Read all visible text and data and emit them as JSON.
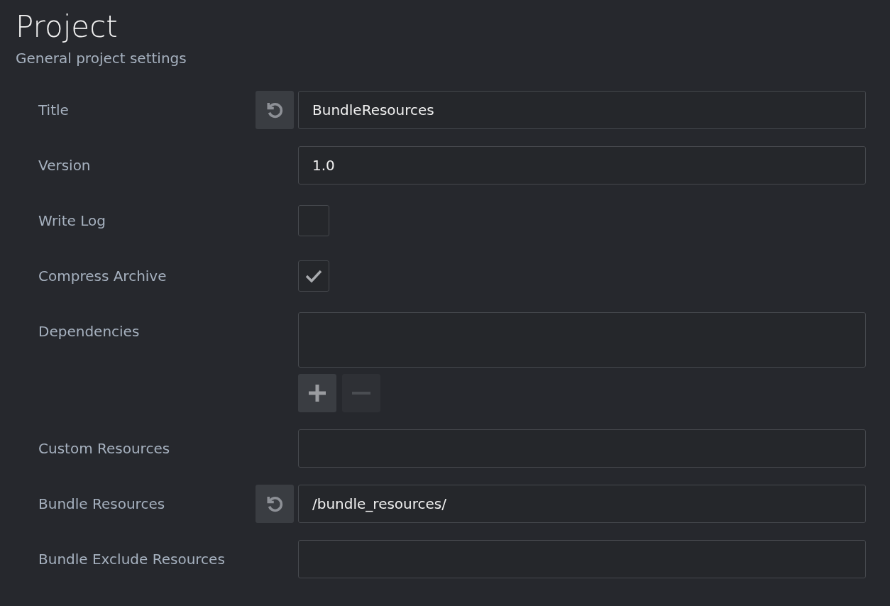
{
  "header": {
    "title": "Project",
    "subtitle": "General project settings"
  },
  "rows": [
    {
      "kind": "text",
      "label": "Title",
      "value": "BundleResources",
      "overridden": true
    },
    {
      "kind": "text",
      "label": "Version",
      "value": "1.0",
      "overridden": false
    },
    {
      "kind": "checkbox",
      "label": "Write Log",
      "checked": false
    },
    {
      "kind": "checkbox",
      "label": "Compress Archive",
      "checked": true
    },
    {
      "kind": "list",
      "label": "Dependencies",
      "add_disabled": false,
      "remove_disabled": true
    },
    {
      "kind": "text",
      "label": "Custom Resources",
      "value": "",
      "overridden": false
    },
    {
      "kind": "text",
      "label": "Bundle Resources",
      "value": "/bundle_resources/",
      "overridden": true
    },
    {
      "kind": "text",
      "label": "Bundle Exclude Resources",
      "value": "",
      "overridden": false
    }
  ]
}
